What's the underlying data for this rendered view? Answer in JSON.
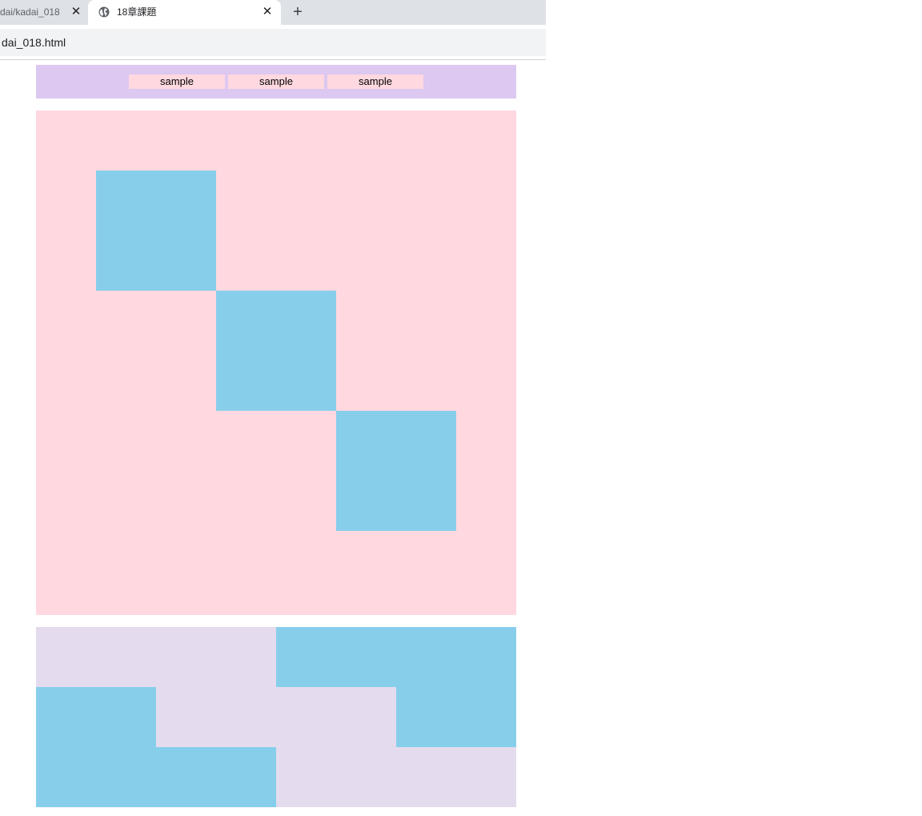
{
  "browser": {
    "tabs": [
      {
        "title": "dai/kadai_018",
        "close": "✕"
      },
      {
        "title": "18章課題",
        "close": "✕",
        "icon": "globe-icon"
      }
    ],
    "new_tab": "+",
    "url": "dai_018.html"
  },
  "page": {
    "nav": [
      "sample",
      "sample",
      "sample"
    ]
  },
  "colors": {
    "header_bg": "#dcc8f0",
    "nav_bg": "#ffd8e0",
    "pink_bg": "#ffd8e0",
    "square": "#87ceeb",
    "bottom_bg": "#e4dcee"
  }
}
